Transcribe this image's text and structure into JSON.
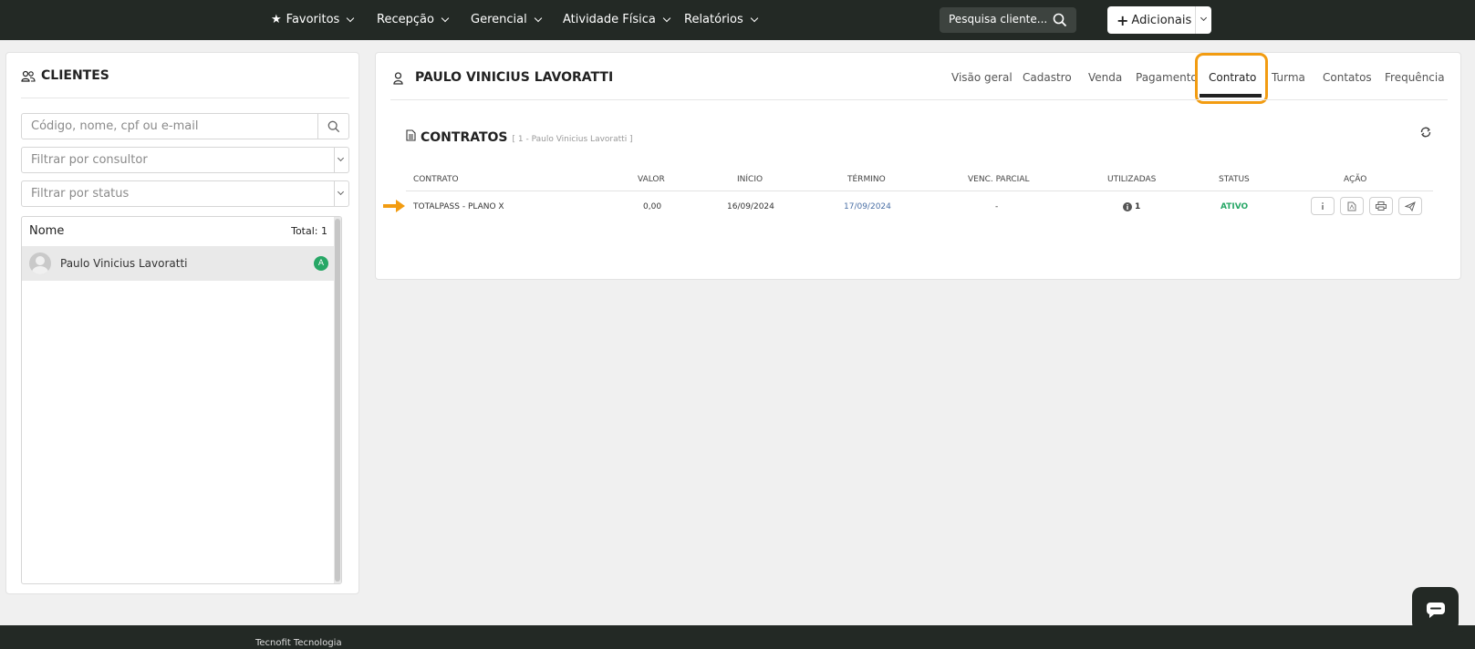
{
  "nav": {
    "favorites": "Favoritos",
    "reception": "Recepção",
    "management": "Gerencial",
    "physical_activity": "Atividade Física",
    "reports": "Relatórios",
    "search_placeholder": "Pesquisa cliente...",
    "add_label": "Adicionais"
  },
  "clients_panel": {
    "title": "CLIENTES",
    "search_placeholder": "Código, nome, cpf ou e-mail",
    "consultant_filter": "Filtrar por consultor",
    "status_filter": "Filtrar por status",
    "list_header": "Nome",
    "total": "Total: 1",
    "clients": [
      {
        "name": "Paulo Vinicius Lavoratti",
        "status_badge": "A"
      }
    ]
  },
  "client_detail": {
    "name": "PAULO VINICIUS LAVORATTI",
    "tabs": [
      "Visão geral",
      "Cadastro",
      "Venda",
      "Pagamento",
      "Contrato",
      "Turma",
      "Contatos",
      "Frequência"
    ],
    "active_tab": "Contrato"
  },
  "contracts": {
    "title": "CONTRATOS",
    "subtitle": "[ 1 - Paulo Vinicius Lavoratti ]",
    "columns": [
      "CONTRATO",
      "VALOR",
      "INÍCIO",
      "TÉRMINO",
      "VENC. PARCIAL",
      "UTILIZADAS",
      "STATUS",
      "AÇÃO"
    ],
    "rows": [
      {
        "contract": "TOTALPASS - PLANO X",
        "value": "0,00",
        "start": "16/09/2024",
        "end": "17/09/2024",
        "partial_due": "-",
        "used": "1",
        "status": "ATIVO"
      }
    ]
  },
  "footer": {
    "company": "Tecnofit Tecnologia"
  },
  "colors": {
    "nav_bg": "#232925",
    "accent_orange": "#f29c11",
    "status_green": "#27a766",
    "link_blue": "#4a6fa5"
  }
}
